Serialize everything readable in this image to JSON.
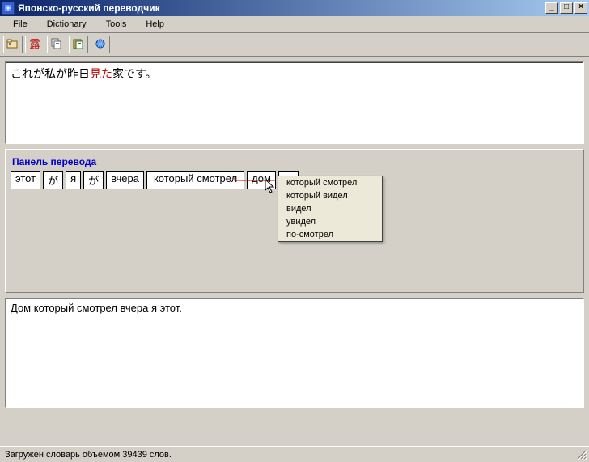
{
  "title": "Японско-русский переводчик",
  "menu": {
    "file": "File",
    "dictionary": "Dictionary",
    "tools": "Tools",
    "help": "Help"
  },
  "toolbar_icons": {
    "open": "open-icon",
    "kanji": "kanji-icon",
    "copy": "copy-icon",
    "paste": "paste-icon",
    "web": "web-icon"
  },
  "source": {
    "pre": "これが私が昨日",
    "highlight": "見た",
    "post": "家です。"
  },
  "panel": {
    "title": "Панель перевода",
    "tokens": [
      {
        "text": "этот"
      },
      {
        "text": "が"
      },
      {
        "text": "я"
      },
      {
        "text": "が"
      },
      {
        "text": "вчера"
      },
      {
        "text": "который смотрел"
      },
      {
        "text": "дом"
      },
      {
        "text": "。"
      }
    ],
    "popup": [
      "который смотрел",
      "который видел",
      "видел",
      "увидел",
      "по-смотрел"
    ]
  },
  "output": "Дом который смотрел вчера я этот.",
  "status": "Загружен словарь объемом 39439 слов.",
  "winbuttons": {
    "min": "_",
    "max": "□",
    "close": "×"
  }
}
